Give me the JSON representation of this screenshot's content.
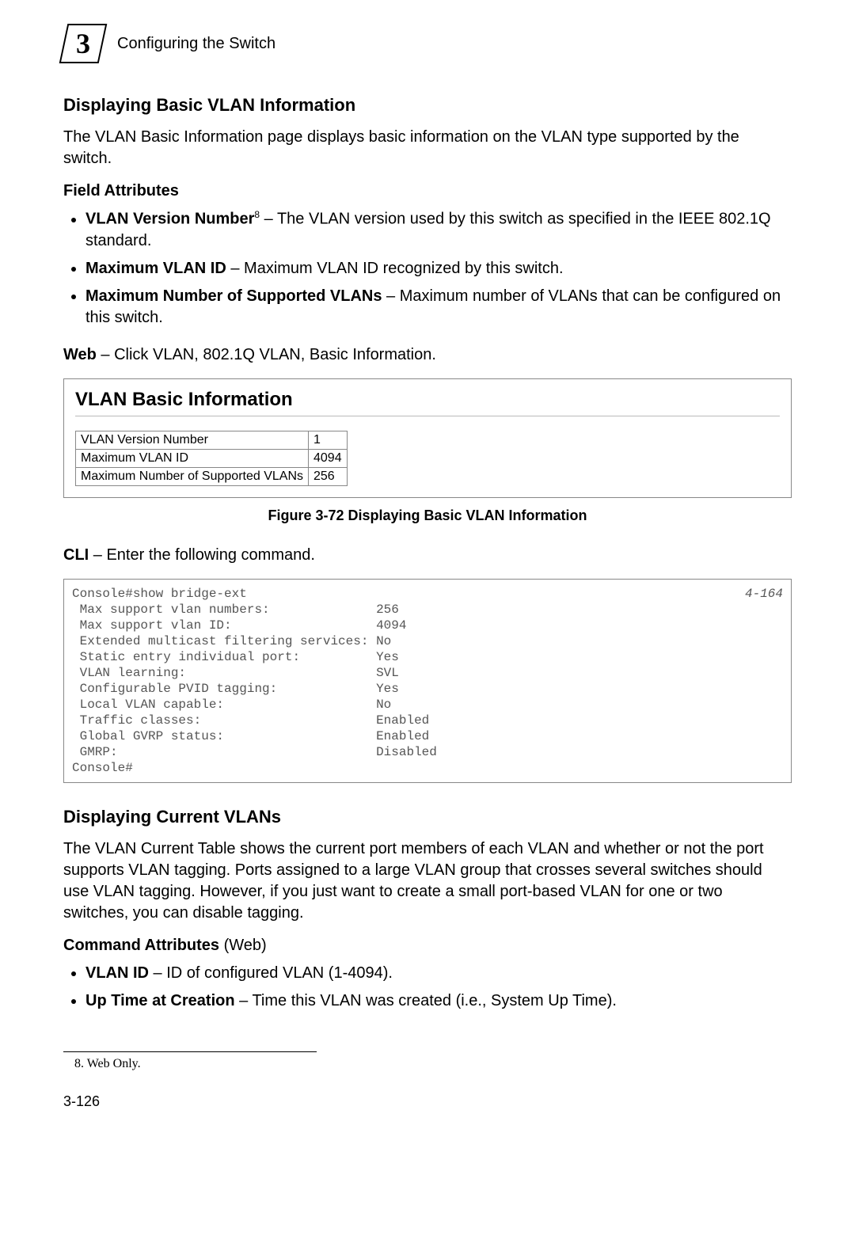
{
  "chapter": {
    "number": "3",
    "title": "Configuring the Switch"
  },
  "section1": {
    "heading": "Displaying Basic VLAN Information",
    "intro": "The VLAN Basic Information page displays basic information on the VLAN type supported by the switch.",
    "fieldAttributesHeading": "Field Attributes",
    "bullets": {
      "b1_term": "VLAN Version Number",
      "b1_sup": "8",
      "b1_text": " – The VLAN version used by this switch as specified in the IEEE 802.1Q standard.",
      "b2_term": "Maximum VLAN ID",
      "b2_text": " – Maximum VLAN ID recognized by this switch.",
      "b3_term": "Maximum Number of Supported VLANs",
      "b3_text": " – Maximum number of VLANs that can be configured on this switch."
    },
    "webLine_bold": "Web",
    "webLine_rest": " – Click VLAN, 802.1Q VLAN, Basic Information.",
    "figure": {
      "title": "VLAN Basic Information",
      "rows": {
        "r1_label": "VLAN Version Number",
        "r1_value": "1",
        "r2_label": "Maximum VLAN ID",
        "r2_value": "4094",
        "r3_label": "Maximum Number of Supported VLANs",
        "r3_value": "256"
      },
      "caption": "Figure 3-72  Displaying Basic VLAN Information"
    },
    "cliLine_bold": "CLI",
    "cliLine_rest": " – Enter the following command.",
    "cli_ref": "4-164",
    "cli_text": "Console#show bridge-ext\n Max support vlan numbers:              256\n Max support vlan ID:                   4094\n Extended multicast filtering services: No\n Static entry individual port:          Yes\n VLAN learning:                         SVL\n Configurable PVID tagging:             Yes\n Local VLAN capable:                    No\n Traffic classes:                       Enabled\n Global GVRP status:                    Enabled\n GMRP:                                  Disabled\nConsole#"
  },
  "section2": {
    "heading": "Displaying Current VLANs",
    "intro": "The VLAN Current Table shows the current port members of each VLAN and whether or not the port supports VLAN tagging. Ports assigned to a large VLAN group that crosses several switches should use VLAN tagging. However, if you just want to create a small port-based VLAN for one or two switches, you can disable tagging.",
    "cmdAttr_bold": "Command Attributes",
    "cmdAttr_rest": " (Web)",
    "bullets": {
      "b1_term": "VLAN ID",
      "b1_text": " – ID of configured VLAN (1-4094).",
      "b2_term": "Up Time at Creation",
      "b2_text": " – Time this VLAN was created (i.e., System Up Time)."
    }
  },
  "footnote": "8.  Web Only.",
  "pageNumber": "3-126"
}
